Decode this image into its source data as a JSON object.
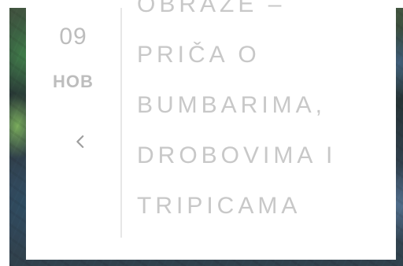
{
  "post": {
    "date": {
      "day": "09",
      "month": "НОВ"
    },
    "title": "OBRAZE –\nPRIČA O\nBUMBARIMA,\nDROBOVIMA I\nTRIPICAMA"
  },
  "controls": {
    "prev_icon": "chevron-left-icon"
  },
  "colors": {
    "text_muted": "#c8c8c8",
    "date_muted": "#bdbdbd",
    "divider": "#e7e7e7",
    "card_bg": "#ffffff"
  }
}
